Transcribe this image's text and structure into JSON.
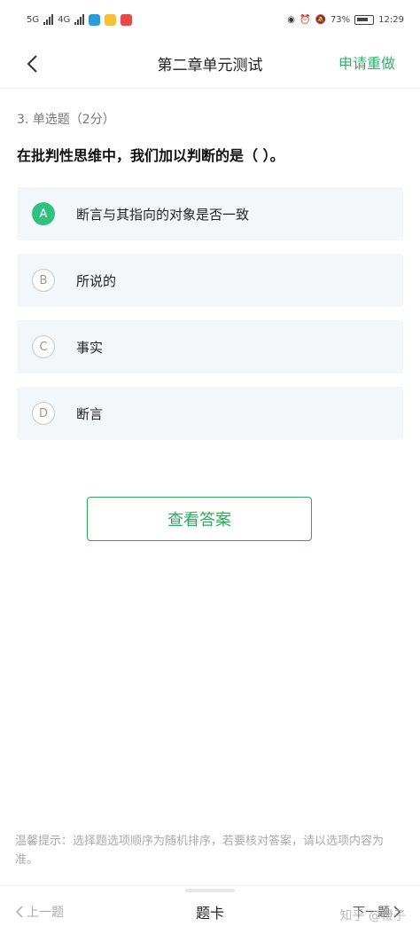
{
  "status_bar": {
    "network_1": "5G",
    "network_2": "4G",
    "battery_pct": "73%",
    "time": "12:29"
  },
  "header": {
    "title": "第二章单元测试",
    "redo_label": "申请重做"
  },
  "question": {
    "meta": "3. 单选题（2分）",
    "text": "在批判性思维中，我们加以判断的是（ ）。",
    "options": [
      {
        "letter": "A",
        "text": "断言与其指向的对象是否一致",
        "selected": true
      },
      {
        "letter": "B",
        "text": "所说的",
        "selected": false
      },
      {
        "letter": "C",
        "text": "事实",
        "selected": false
      },
      {
        "letter": "D",
        "text": "断言",
        "selected": false
      }
    ]
  },
  "answer_button": "查看答案",
  "tip": "温馨提示：选择题选项顺序为随机排序，若要核对答案，请以选项内容为准。",
  "bottom_nav": {
    "prev": "上一题",
    "card": "题卡",
    "next": "下一题"
  },
  "watermark": "知乎 @橙子",
  "colors": {
    "accent": "#2ec27e",
    "button_green": "#2ea85a",
    "option_bg": "#f3f7fa"
  }
}
